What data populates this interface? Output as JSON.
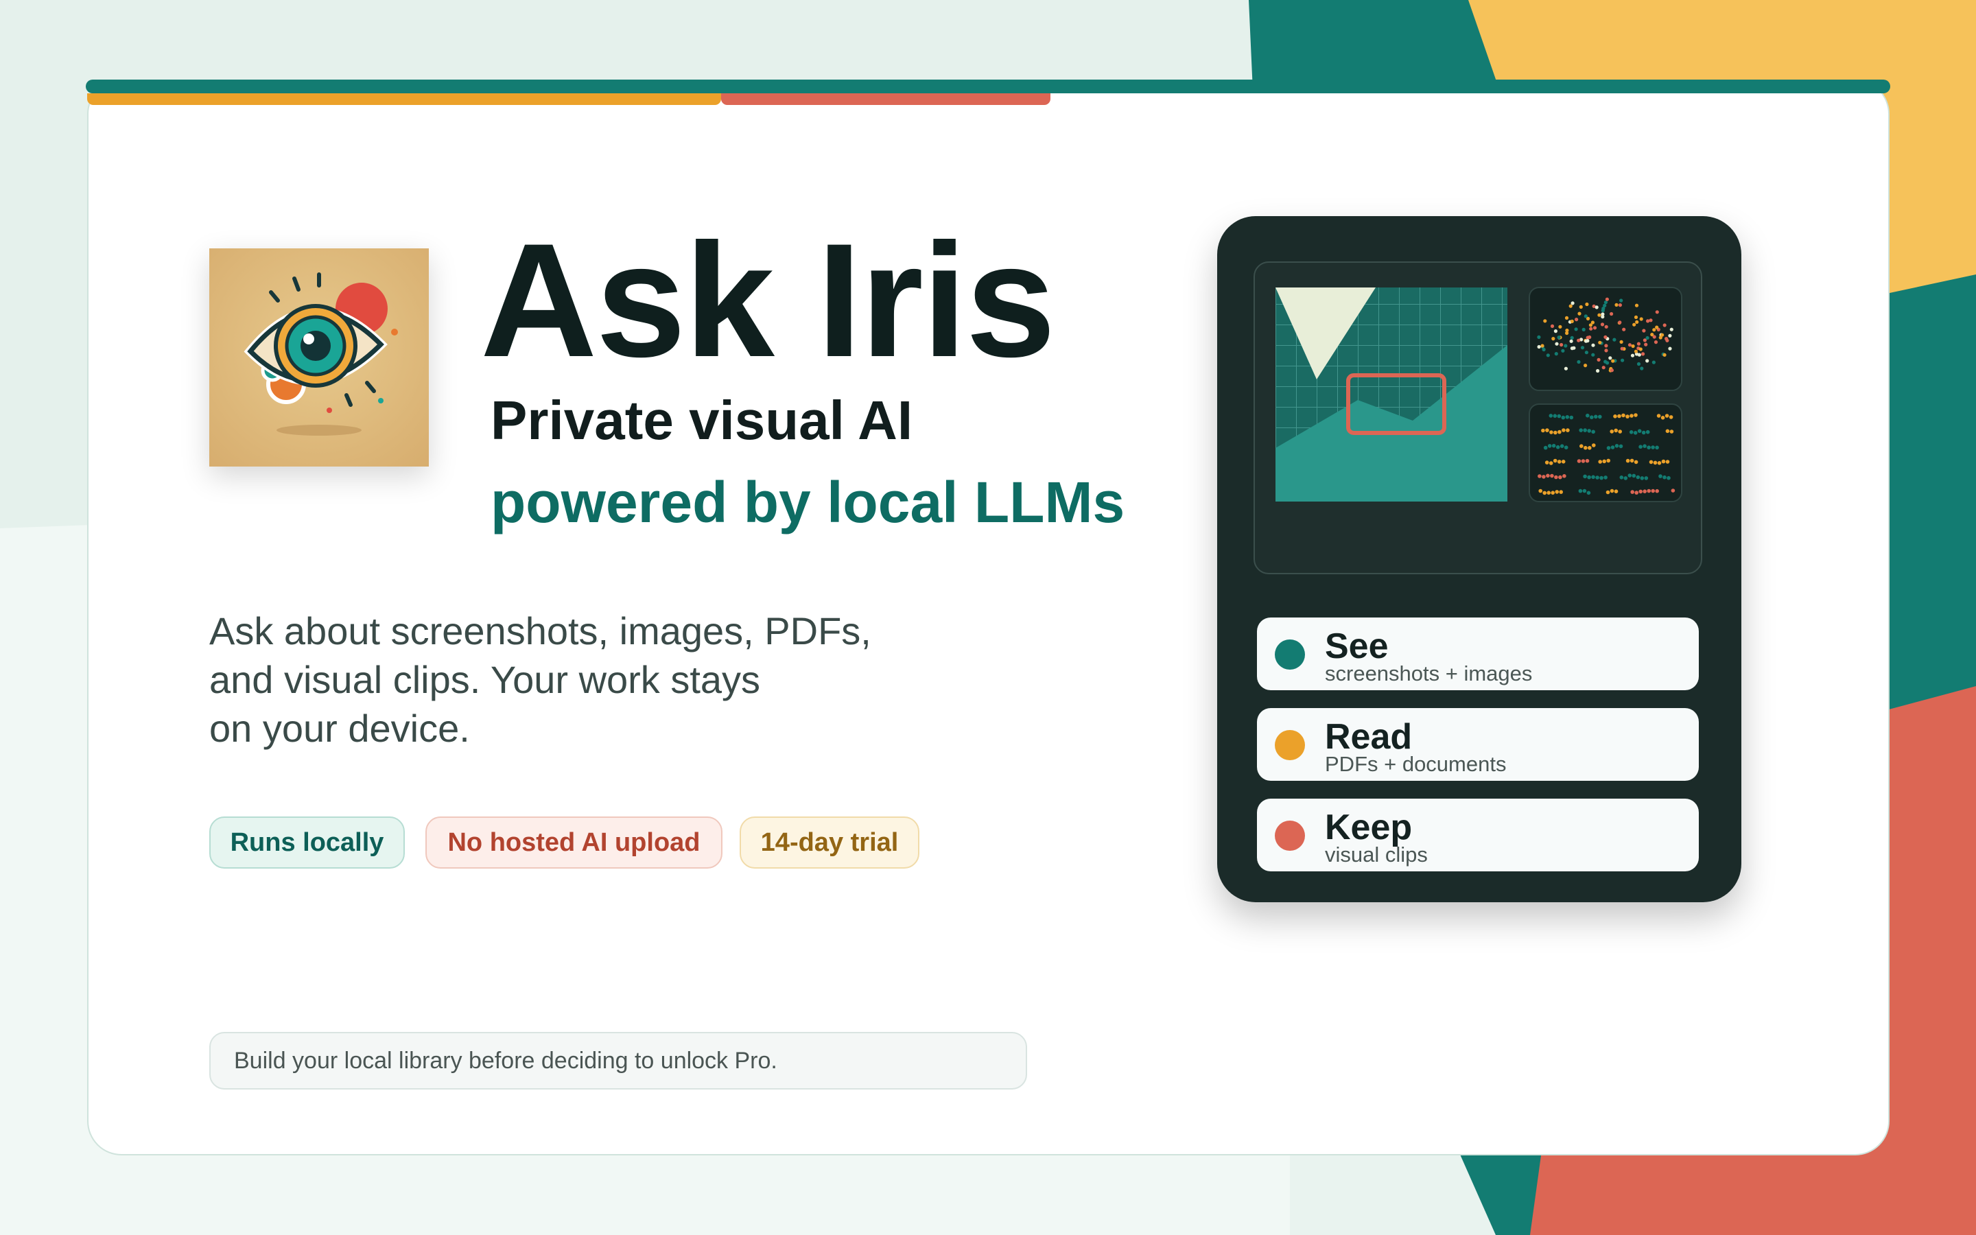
{
  "app": {
    "name": "Ask Iris",
    "tagline_line1": "Private visual AI",
    "tagline_line2": "powered by local LLMs"
  },
  "description_lines": [
    "Ask about screenshots, images, PDFs,",
    "and visual clips. Your work stays",
    "on your device."
  ],
  "badges": [
    "Runs locally",
    "No hosted AI upload",
    "14-day trial"
  ],
  "note": "Build your local library before deciding to unlock Pro.",
  "features": [
    {
      "title": "See",
      "subtitle": "screenshots + images",
      "color": "#137c72"
    },
    {
      "title": "Read",
      "subtitle": "PDFs + documents",
      "color": "#eba12a"
    },
    {
      "title": "Keep",
      "subtitle": "visual clips",
      "color": "#dc6654"
    }
  ],
  "colors": {
    "teal": "#137c72",
    "amber": "#eba12a",
    "coral": "#dc6654",
    "yellow": "#f6c25a",
    "panel": "#1b2b29"
  }
}
